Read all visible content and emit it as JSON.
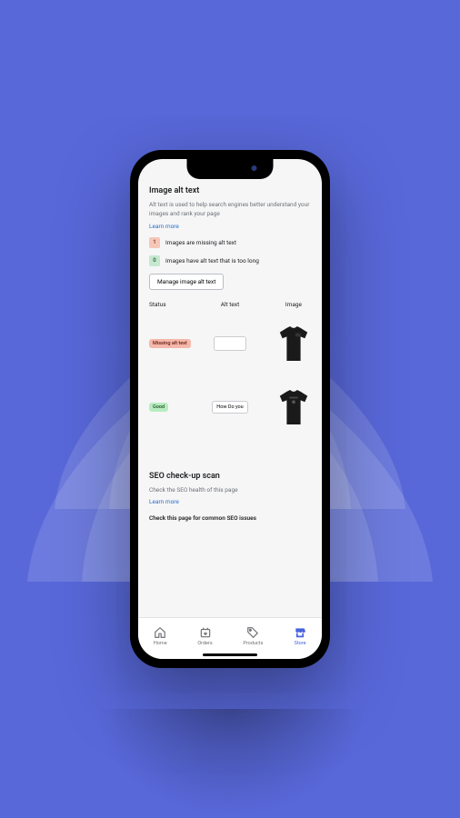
{
  "sections": {
    "altText": {
      "title": "Image alt text",
      "description": "Alt text is used to help search engines better understand your images and rank your page",
      "learnMore": "Learn more",
      "alerts": [
        {
          "count": "1",
          "type": "warn",
          "text": "Images are missing alt text"
        },
        {
          "count": "0",
          "type": "ok",
          "text": "Images have alt text that is too long"
        }
      ],
      "manageButton": "Manage image alt text",
      "columns": {
        "status": "Status",
        "altText": "Alt text",
        "image": "Image"
      },
      "rows": [
        {
          "status": "Missing alt text",
          "statusType": "missing",
          "altValue": "",
          "inputType": "input"
        },
        {
          "status": "Good",
          "statusType": "good",
          "altValue": "How Do you",
          "inputType": "button"
        }
      ]
    },
    "seoScan": {
      "title": "SEO check-up scan",
      "description": "Check the SEO health of this page",
      "learnMore": "Learn more",
      "checkText": "Check this page for common SEO issues"
    }
  },
  "tabs": [
    {
      "id": "home",
      "label": "Home",
      "active": false
    },
    {
      "id": "orders",
      "label": "Orders",
      "active": false
    },
    {
      "id": "products",
      "label": "Products",
      "active": false
    },
    {
      "id": "store",
      "label": "Store",
      "active": true
    }
  ]
}
